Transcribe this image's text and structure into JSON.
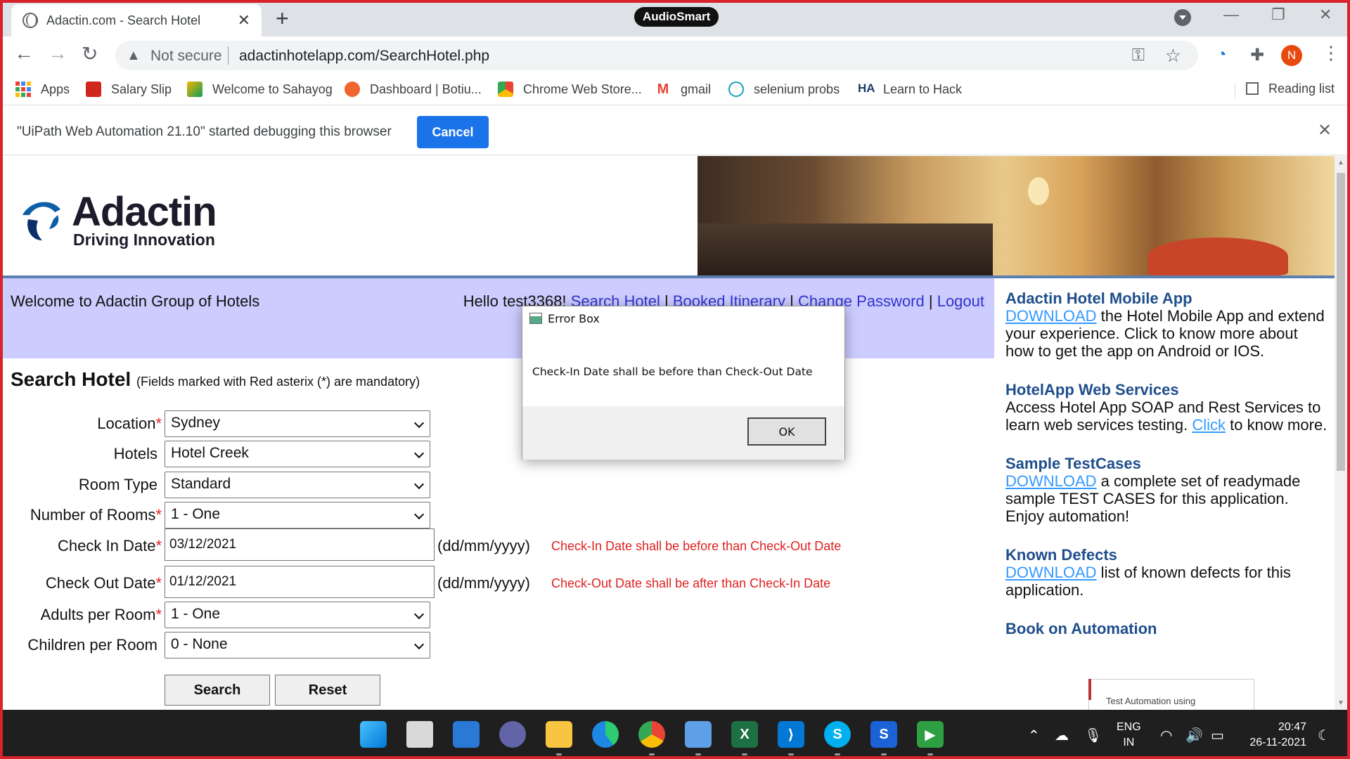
{
  "browser": {
    "tab_title": "Adactin.com - Search Hotel",
    "audiosmart": "AudioSmart",
    "not_secure": "Not secure",
    "url": "adactinhotelapp.com/SearchHotel.php",
    "avatar_letter": "N",
    "bookmarks": [
      {
        "label": "Apps",
        "icon": "apps-grid-icon"
      },
      {
        "label": "Salary Slip",
        "icon": "adp-icon"
      },
      {
        "label": "Welcome to Sahayog",
        "icon": "sahayog-icon"
      },
      {
        "label": "Dashboard | Botiu...",
        "icon": "botium-icon"
      },
      {
        "label": "Chrome Web Store...",
        "icon": "webstore-icon"
      },
      {
        "label": "gmail",
        "icon": "gmail-icon"
      },
      {
        "label": "selenium probs",
        "icon": "selenium-icon"
      },
      {
        "label": "Learn to Hack",
        "icon": "hack-icon"
      }
    ],
    "reading_list": "Reading list",
    "infobar_message": "\"UiPath Web Automation 21.10\" started debugging this browser",
    "infobar_cancel": "Cancel"
  },
  "site": {
    "logo_name": "Adactin",
    "logo_tagline": "Driving Innovation",
    "welcome": "Welcome to Adactin Group of Hotels",
    "hello": "Hello test3368!",
    "nav": [
      "Search Hotel",
      "Booked Itinerary",
      "Change Password",
      "Logout"
    ],
    "search_title": "Search Hotel",
    "search_note": "(Fields marked with Red asterix (*) are mandatory)",
    "form": {
      "location_label": "Location",
      "location_value": "Sydney",
      "hotels_label": "Hotels",
      "hotels_value": "Hotel Creek",
      "room_type_label": "Room Type",
      "room_type_value": "Standard",
      "rooms_label": "Number of Rooms",
      "rooms_value": "1 - One",
      "checkin_label": "Check In Date",
      "checkin_value": "03/12/2021",
      "checkin_format": "(dd/mm/yyyy)",
      "checkin_error": "Check-In Date shall be before than Check-Out Date",
      "checkout_label": "Check Out Date",
      "checkout_value": "01/12/2021",
      "checkout_format": "(dd/mm/yyyy)",
      "checkout_error": "Check-Out Date shall be after than Check-In Date",
      "adults_label": "Adults per Room",
      "adults_value": "1 - One",
      "children_label": "Children per Room",
      "children_value": "0 - None",
      "asterisk": "*",
      "search_button": "Search",
      "reset_button": "Reset"
    },
    "sidebar": {
      "mobile_title": "Adactin Hotel Mobile App",
      "mobile_link": "DOWNLOAD",
      "mobile_text": " the Hotel Mobile App and extend your experience. Click to know more about how to get the app on Android or IOS.",
      "ws_title": "HotelApp Web Services",
      "ws_text": "Access Hotel App SOAP and Rest Services to learn web services testing. ",
      "ws_link": "Click",
      "ws_text2": " to know more.",
      "tc_title": "Sample TestCases",
      "tc_link": "DOWNLOAD",
      "tc_text": " a complete set of readymade sample TEST CASES for this application. Enjoy automation!",
      "kd_title": "Known Defects",
      "kd_link": "DOWNLOAD",
      "kd_text": " list of known defects for this application.",
      "book_title": "Book on Automation",
      "book_cover_text": "Test Automation using"
    }
  },
  "dialog": {
    "title": "Error Box",
    "message": "Check-In Date shall be before than Check-Out Date",
    "ok": "OK"
  },
  "taskbar": {
    "lang_1": "ENG",
    "lang_2": "IN",
    "time": "20:47",
    "date": "26-11-2021"
  },
  "colors": {
    "frame": "#d8232a",
    "welcome_bg": "#ccccff",
    "nav_link": "#3333cc",
    "error_red": "#e02020",
    "sidebar_heading": "#1f4e8c",
    "chrome_blue": "#1a73e8"
  }
}
